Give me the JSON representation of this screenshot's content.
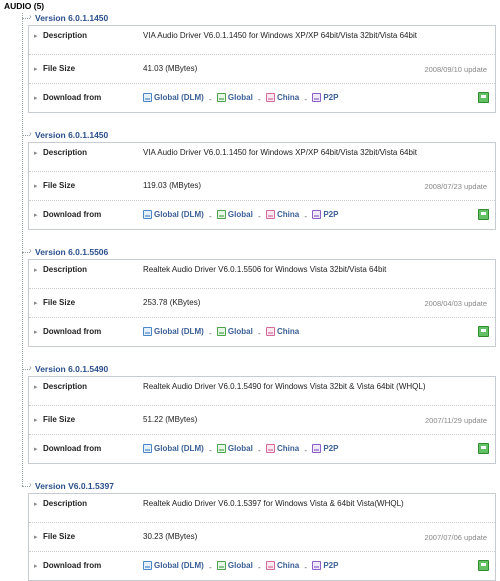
{
  "section": {
    "title": "AUDIO (5)"
  },
  "labels": {
    "description": "Description",
    "file_size": "File Size",
    "download_from": "Download from"
  },
  "link_names": {
    "global_dlm": "Global (DLM)",
    "global": "Global",
    "china": "China",
    "p2p": "P2P"
  },
  "separator": "-",
  "icons": {
    "row_arrow": "chevron-right-icon",
    "tree_arrow": "tree-arrow-icon",
    "download": "green-download-icon"
  },
  "colors": {
    "version_title": "#2a4f8c",
    "link": "#3a5f95",
    "date": "#888888",
    "border": "#c6ccd2"
  },
  "versions": [
    {
      "version": "Version 6.0.1.1450",
      "description": "VIA Audio Driver V6.0.1.1450 for Windows XP/XP 64bit/Vista 32bit/Vista 64bit",
      "file_size": "41.03 (MBytes)",
      "date": "2008/09/10 update",
      "has_p2p": true
    },
    {
      "version": "Version 6.0.1.1450",
      "description": "VIA Audio Driver V6.0.1.1450 for Windows XP/XP 64bit/Vista 32bit/Vista 64bit",
      "file_size": "119.03 (MBytes)",
      "date": "2008/07/23 update",
      "has_p2p": true
    },
    {
      "version": "Version 6.0.1.5506",
      "description": "Realtek Audio Driver V6.0.1.5506 for Windows Vista 32bit/Vista 64bit",
      "file_size": "253.78 (KBytes)",
      "date": "2008/04/03 update",
      "has_p2p": false
    },
    {
      "version": "Version 6.0.1.5490",
      "description": "Realtek Audio Driver V6.0.1.5490 for Windows Vista 32bit & Vista 64bit (WHQL)",
      "file_size": "51.22 (MBytes)",
      "date": "2007/11/29 update",
      "has_p2p": true
    },
    {
      "version": "Version V6.0.1.5397",
      "description": "Realtek Audio Driver V6.0.1.5397 for Windows Vista & 64bit Vista(WHQL)",
      "file_size": "30.23 (MBytes)",
      "date": "2007/07/06 update",
      "has_p2p": true
    }
  ]
}
